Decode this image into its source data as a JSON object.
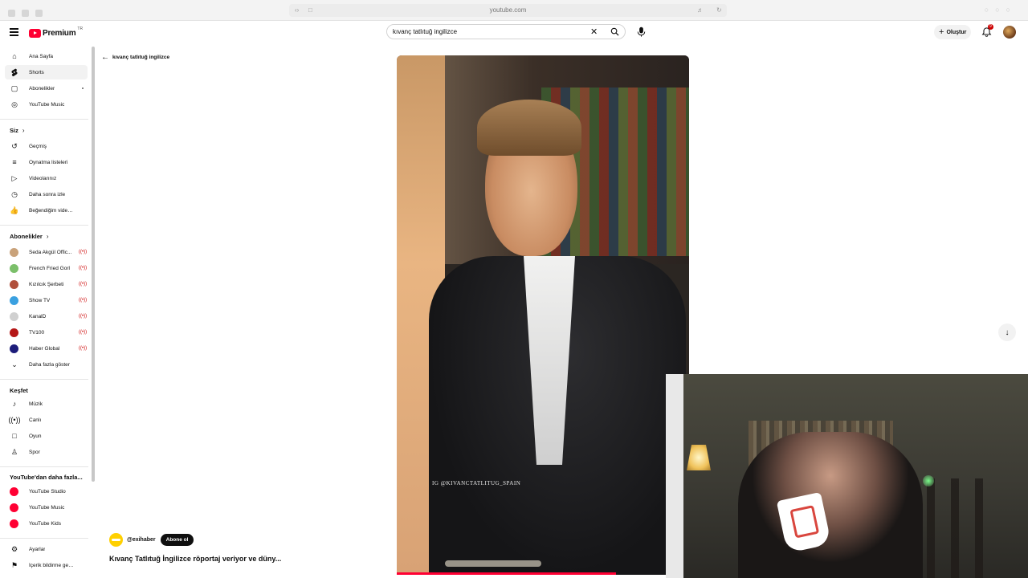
{
  "browser": {
    "url": "youtube.com"
  },
  "masthead": {
    "logo_text": "Premium",
    "logo_country": "TR",
    "search_value": "kıvanç tatlıtuğ ingilizce",
    "create_label": "Oluştur",
    "notification_count": "9"
  },
  "sidebar": {
    "main": [
      {
        "label": "Ana Sayfa",
        "icon": "home-icon"
      },
      {
        "label": "Shorts",
        "icon": "shorts-icon",
        "active": true
      },
      {
        "label": "Abonelikler",
        "icon": "subscriptions-icon"
      },
      {
        "label": "YouTube Music",
        "icon": "music-circle-icon"
      }
    ],
    "you_heading": "Siz",
    "you": [
      {
        "label": "Geçmiş",
        "icon": "history-icon"
      },
      {
        "label": "Oynatma listeleri",
        "icon": "playlists-icon"
      },
      {
        "label": "Videolarınız",
        "icon": "your-videos-icon"
      },
      {
        "label": "Daha sonra izle",
        "icon": "watch-later-icon"
      },
      {
        "label": "Beğendiğim videolar",
        "icon": "liked-icon"
      }
    ],
    "subs_heading": "Abonelikler",
    "subs": [
      {
        "label": "Seda Akgül Offic...",
        "color": "#c9a27a"
      },
      {
        "label": "French Fried Gorl",
        "color": "#7bbf6a"
      },
      {
        "label": "Kızılcık Şerbeti",
        "color": "#b0503c"
      },
      {
        "label": "Show TV",
        "color": "#3aa0e0"
      },
      {
        "label": "KanalD",
        "color": "#d0d0d0"
      },
      {
        "label": "TV100",
        "color": "#b51717"
      },
      {
        "label": "Haber Global",
        "color": "#1c1c7a"
      }
    ],
    "show_more": "Daha fazla göster",
    "explore_heading": "Keşfet",
    "explore": [
      {
        "label": "Müzik",
        "icon": "music-note-icon"
      },
      {
        "label": "Canlı",
        "icon": "live-icon"
      },
      {
        "label": "Oyun",
        "icon": "gaming-icon"
      },
      {
        "label": "Spor",
        "icon": "trophy-icon"
      }
    ],
    "more_heading": "YouTube'dan daha fazla...",
    "more": [
      {
        "label": "YouTube Studio"
      },
      {
        "label": "YouTube Music"
      },
      {
        "label": "YouTube Kids"
      }
    ],
    "settings": [
      {
        "label": "Ayarlar"
      },
      {
        "label": "İçerik bildirme geç..."
      }
    ]
  },
  "page": {
    "back_label": "kıvanç tatlıtuğ ingilizce",
    "watermark": "IG @KIVANCTATLITUG_SPAIN",
    "progress": 0.75,
    "channel_handle": "@exihaber",
    "subscribe_label": "Abone ol",
    "video_title": "Kıvanç Tatlıtuğ İngilizce röportaj veriyor ve düny..."
  },
  "colors": {
    "brand": "#ff0033",
    "live": "#cc0000"
  }
}
